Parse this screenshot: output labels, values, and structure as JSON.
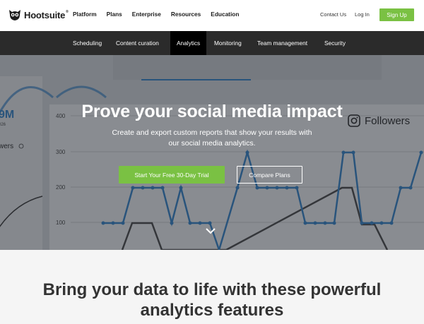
{
  "header": {
    "brand": "Hootsuite",
    "brand_reg": "®",
    "nav": [
      {
        "label": "Platform"
      },
      {
        "label": "Plans"
      },
      {
        "label": "Enterprise"
      },
      {
        "label": "Resources"
      },
      {
        "label": "Education"
      }
    ],
    "contact": "Contact Us",
    "login": "Log In",
    "signup": "Sign Up"
  },
  "subnav": {
    "tabs": [
      {
        "label": "Scheduling",
        "active": false
      },
      {
        "label": "Content curation",
        "active": false
      },
      {
        "label": "Analytics",
        "active": true
      },
      {
        "label": "Monitoring",
        "active": false
      },
      {
        "label": "Team management",
        "active": false
      },
      {
        "label": "Security",
        "active": false
      }
    ]
  },
  "hero": {
    "title": "Prove your social media impact",
    "subtitle": "Create and export custom reports that show your results with our social media analytics.",
    "cta_primary": "Start Your Free 30-Day Trial",
    "cta_secondary": "Compare Plans",
    "background_card": {
      "metric_value": "9M",
      "metric_sub": "026",
      "followers_label": "wers",
      "followers_title": "Followers",
      "y_ticks": [
        "400",
        "300",
        "200",
        "100"
      ]
    }
  },
  "features": {
    "title_line1": "Bring your data to life with these powerful",
    "title_line2": "analytics features"
  },
  "colors": {
    "accent_green": "#7ac143",
    "nav_dark": "#2b2b2b",
    "active_tab": "#000000",
    "chart_blue": "#2f80c8"
  }
}
